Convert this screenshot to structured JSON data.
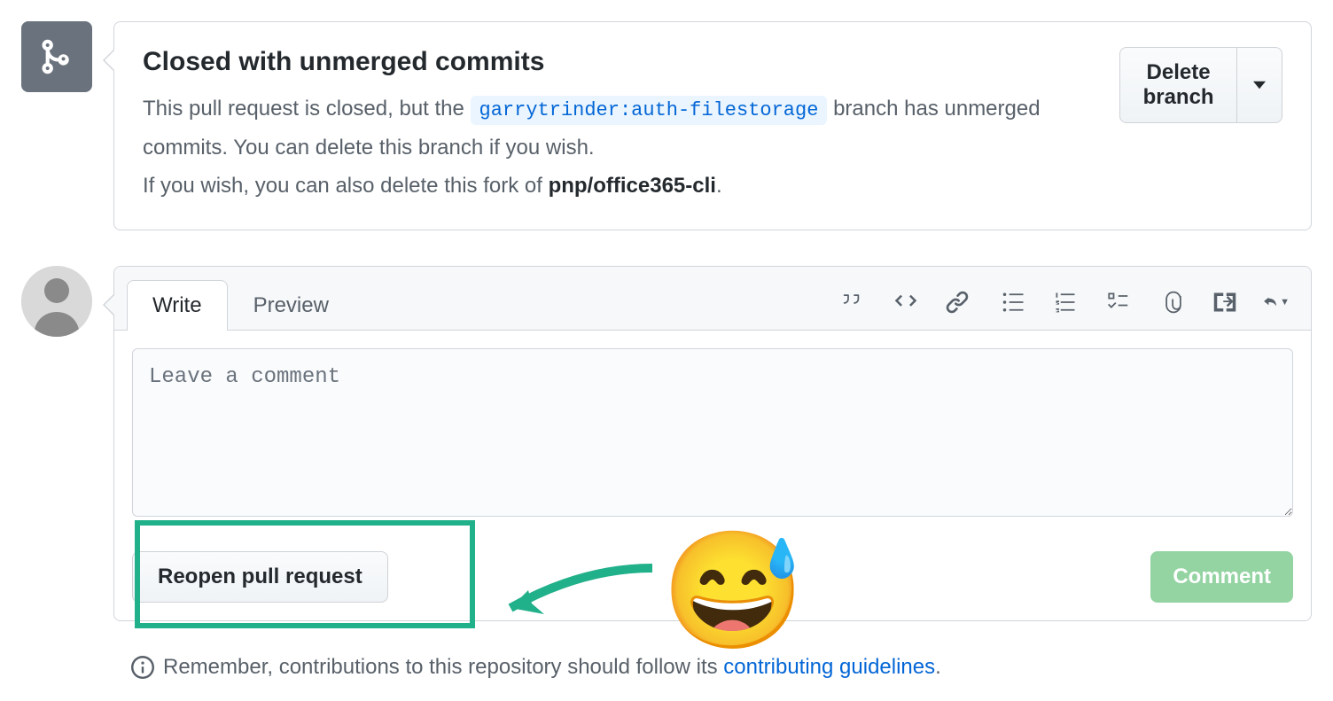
{
  "merge": {
    "title": "Closed with unmerged commits",
    "text_before": "This pull request is closed, but the ",
    "branch_tag": "garrytrinder:auth-filestorage",
    "text_after": " branch has unmerged commits. You can delete this branch if you wish.",
    "text_line2_before": "If you wish, you can also delete this fork of ",
    "fork_repo": "pnp/office365-cli",
    "text_line2_after": ".",
    "delete_label": "Delete branch"
  },
  "tabs": {
    "write": "Write",
    "preview": "Preview"
  },
  "comment": {
    "placeholder": "Leave a comment"
  },
  "actions": {
    "reopen": "Reopen pull request",
    "comment": "Comment"
  },
  "footer": {
    "text_before": "Remember, contributions to this repository should follow its ",
    "link": "contributing guidelines",
    "text_after": "."
  },
  "emoji": "😅"
}
